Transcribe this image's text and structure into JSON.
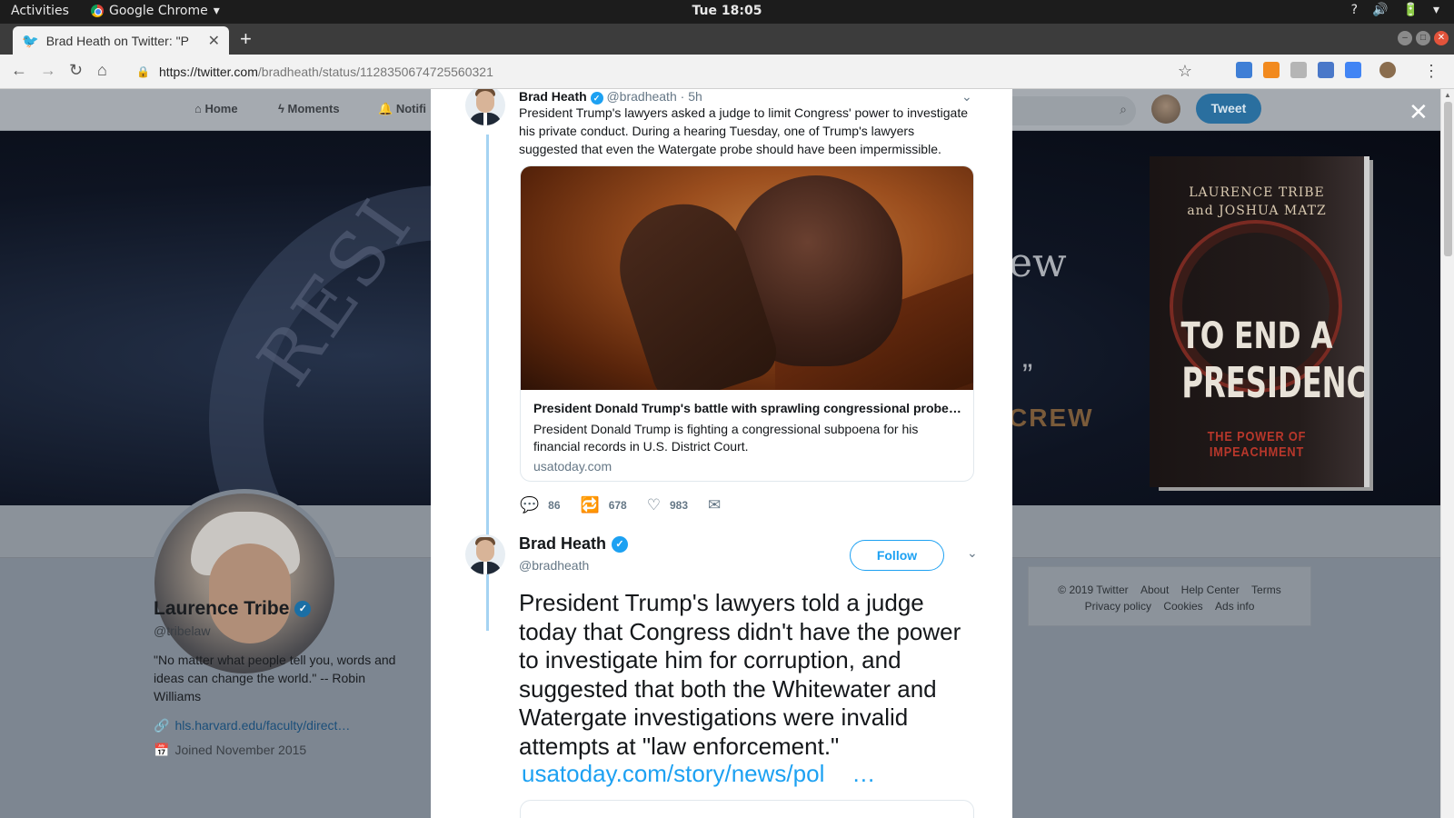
{
  "system_bar": {
    "activities": "Activities",
    "app_name": "Google Chrome",
    "clock": "Tue 18:05",
    "tray_help": "?",
    "tray_sound": "🔊",
    "tray_battery": "🔋"
  },
  "browser": {
    "tab_title": "Brad Heath on Twitter: \"P",
    "url_host": "https://twitter.com",
    "url_path": "/bradheath/status/1128350674725560321",
    "colors": {
      "tab_strip": "#3c3c3c",
      "toolbar": "#f2f2f2"
    }
  },
  "twitter_nav": {
    "home": "Home",
    "moments": "Moments",
    "notifications": "Notifi",
    "search_placeholder": "r",
    "tweet_button": "Tweet"
  },
  "banner": {
    "seal_text": "RESI",
    "right_text_1": "ew",
    "right_quote": "”",
    "right_text_2": "CREW",
    "book": {
      "authors_line1": "LAURENCE TRIBE",
      "authors_line2": "and JOSHUA MATZ",
      "title_line1": "TO END A",
      "title_line2": "PRESIDENCY",
      "subtitle": "THE POWER OF IMPEACHMENT"
    }
  },
  "profile": {
    "name": "Laurence Tribe",
    "handle": "@tribelaw",
    "bio": "\"No matter what people tell you, words and ideas can change the world.\" -- Robin Williams",
    "link": "hls.harvard.edu/faculty/direct…",
    "joined": "Joined November 2015"
  },
  "footer": {
    "copyright": "© 2019 Twitter",
    "about": "About",
    "help": "Help Center",
    "terms": "Terms",
    "privacy": "Privacy policy",
    "cookies": "Cookies",
    "ads": "Ads info"
  },
  "tweet1": {
    "name": "Brad Heath",
    "handle": "@bradheath",
    "time": "· 5h",
    "text": "President Trump's lawyers asked a judge to limit Congress' power to investigate his private conduct. During a hearing Tuesday, one of Trump's lawyers suggested that even the Watergate probe should have been impermissible.",
    "card": {
      "title": "President Donald Trump's battle with sprawling congressional probe…",
      "description": "President Donald Trump is fighting a congressional subpoena for his financial records in U.S. District Court.",
      "domain": "usatoday.com"
    },
    "replies": "86",
    "retweets": "678",
    "likes": "983"
  },
  "tweet2": {
    "name": "Brad Heath",
    "handle": "@bradheath",
    "follow_label": "Follow",
    "text": "President Trump's lawyers told a judge today that Congress didn't have the power to investigate him for corruption, and suggested that both the Whitewater and Watergate investigations were invalid attempts at \"law enforcement.\"",
    "link": "usatoday.com/story/news/pol",
    "link_ellipsis": "…"
  },
  "icons": {
    "twitter_bird": "twitter-icon",
    "verified": "verified-badge-icon",
    "reply": "reply-icon",
    "retweet": "retweet-icon",
    "like": "heart-icon",
    "dm": "envelope-icon",
    "close": "close-icon"
  }
}
